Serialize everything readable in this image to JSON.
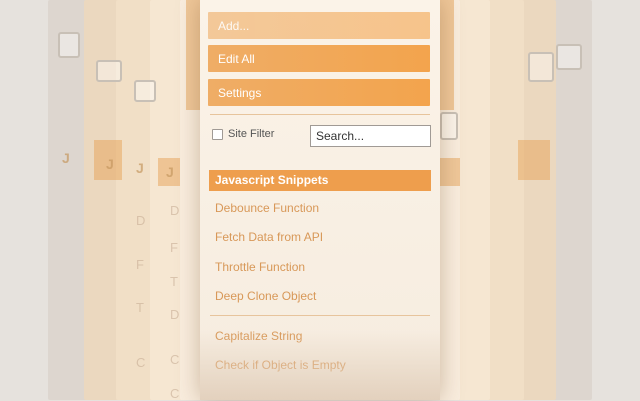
{
  "popup": {
    "buttons": {
      "add": "Add...",
      "edit_all": "Edit All",
      "settings": "Settings"
    },
    "filter": {
      "site_filter_label": "Site Filter",
      "site_filter_checked": false,
      "search_placeholder": "Search...",
      "search_value": ""
    },
    "section": {
      "title": "Javascript Snippets",
      "items": [
        "Debounce Function",
        "Fetch Data from API",
        "Throttle Function",
        "Deep Clone Object",
        "Capitalize String",
        "Check if Object is Empty"
      ]
    }
  },
  "background_ghost": {
    "section_letter": "J",
    "row_letters": [
      "D",
      "F",
      "T",
      "D",
      "C",
      "C"
    ]
  },
  "colors": {
    "accent": "#f3a44d",
    "section_header": "#ee9e4d",
    "snippet_text": "#d89858",
    "popup_bg": "#fbf3e8"
  }
}
